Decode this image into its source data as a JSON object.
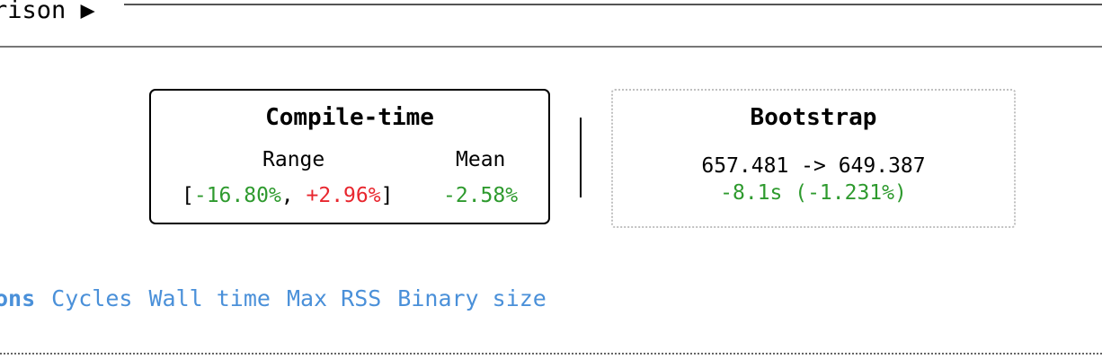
{
  "header": {
    "title": "rison ▶"
  },
  "compile_time": {
    "title": "Compile-time",
    "range_label": "Range",
    "mean_label": "Mean",
    "range_open": "[",
    "range_min": "-16.80%",
    "range_sep": ", ",
    "range_max": "+2.96%",
    "range_close": "]",
    "mean_value": "-2.58%"
  },
  "bootstrap": {
    "title": "Bootstrap",
    "change": "657.481 -> 649.387",
    "delta": "-8.1s (-1.231%)"
  },
  "tabs": [
    {
      "label": "ons",
      "active": true
    },
    {
      "label": "Cycles",
      "active": false
    },
    {
      "label": "Wall time",
      "active": false
    },
    {
      "label": "Max RSS",
      "active": false
    },
    {
      "label": "Binary size",
      "active": false
    }
  ],
  "colors": {
    "improvement": "#2e9a2e",
    "regression": "#e8262e",
    "link": "#4a90d9"
  }
}
